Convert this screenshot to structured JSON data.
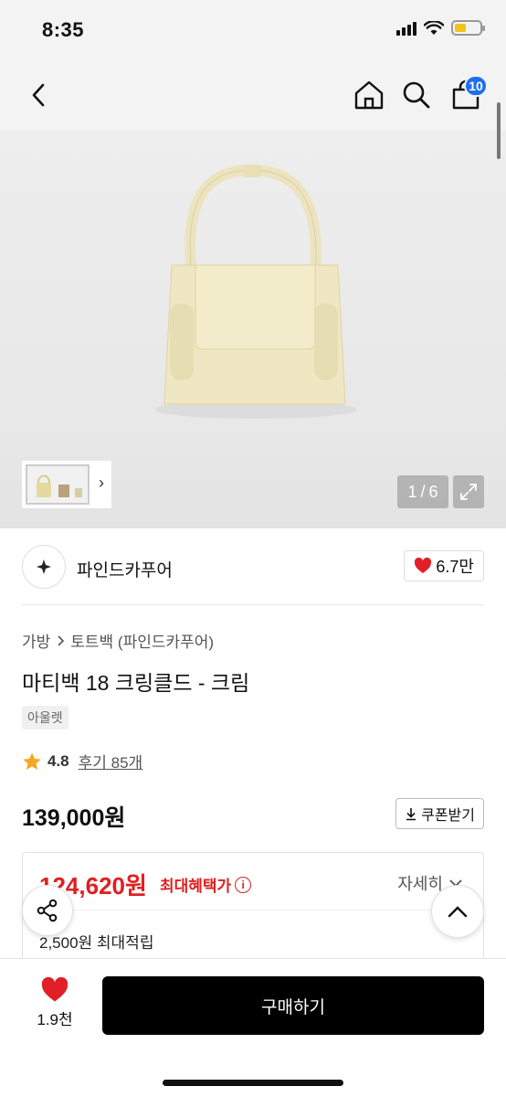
{
  "status_bar": {
    "time": "8:35"
  },
  "nav": {
    "cart_count": "10"
  },
  "product_image": {
    "page_current": "1",
    "page_separator": "/",
    "page_total": "6"
  },
  "brand": {
    "name": "파인드카푸어",
    "likes": "6.7만"
  },
  "breadcrumb": {
    "category": "가방",
    "subcategory": "토트백 (파인드카푸어)"
  },
  "product": {
    "title": "마티백 18 크링클드 - 크림",
    "tag": "아울렛",
    "rating": "4.8",
    "reviews": "후기 85개",
    "price": "139,000원",
    "coupon_label": "쿠폰받기"
  },
  "benefit": {
    "price": "124,620원",
    "label": "최대혜택가",
    "detail": "자세히",
    "points": "2,500원 최대적립"
  },
  "bottom": {
    "wish_count": "1.9천",
    "buy_label": "구매하기"
  },
  "colors": {
    "accent_red": "#e02020",
    "badge_blue": "#1f6ef2",
    "star": "#f5a623",
    "bag_cream": "#efe7c2"
  }
}
